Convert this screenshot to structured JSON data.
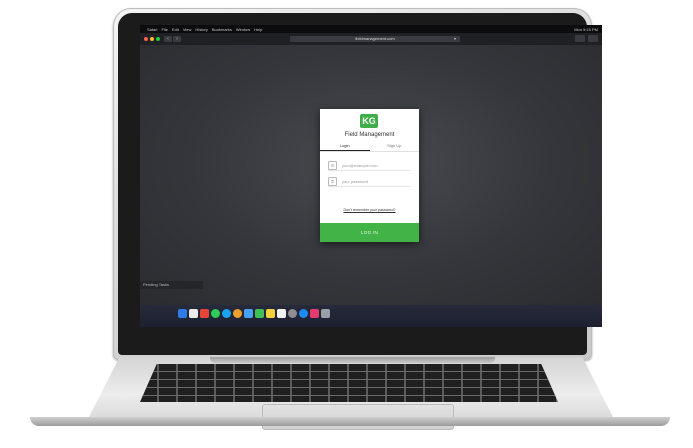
{
  "menubar": {
    "items": [
      "Safari",
      "File",
      "Edit",
      "View",
      "History",
      "Bookmarks",
      "Window",
      "Help"
    ],
    "right": "Mon 5:15 PM"
  },
  "browser": {
    "url": "fieldmanagement.com",
    "nav_back": "‹",
    "nav_forward": "›"
  },
  "login": {
    "logo_text": "KG",
    "title": "Field Management",
    "tabs": [
      "Login",
      "Sign Up"
    ],
    "email_placeholder": "your@example.com",
    "password_placeholder": "your password",
    "forgot_link": "Don't remember your password?",
    "submit_label": "LOG IN"
  },
  "bottom_tab_label": "Pending Tasks",
  "colors": {
    "accent": "#42b347",
    "screen_bg": "#303136"
  },
  "dock_icons": [
    "finder-icon",
    "launchpad-icon",
    "chrome-icon",
    "whatsapp-icon",
    "skype-icon",
    "safari-icon",
    "mail-icon",
    "numbers-icon",
    "photos-icon",
    "calendar-icon",
    "settings-icon",
    "appstore-icon",
    "music-icon",
    "trash-icon"
  ]
}
